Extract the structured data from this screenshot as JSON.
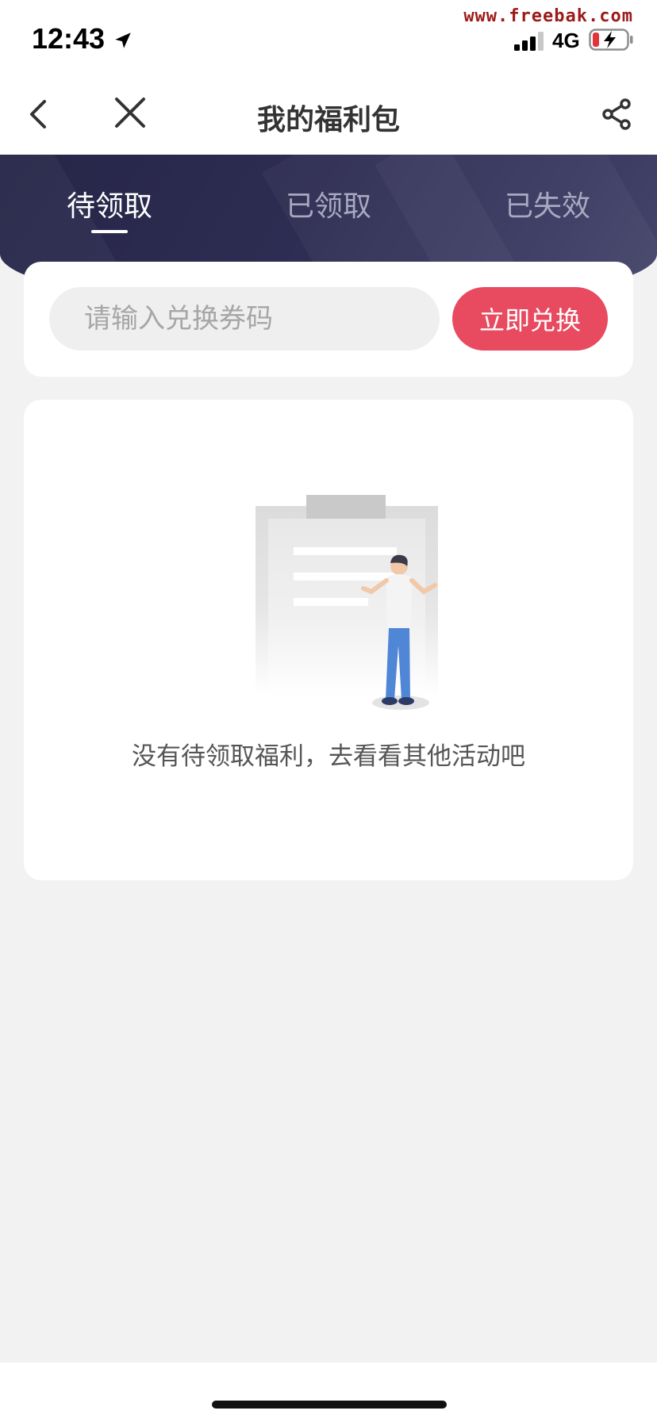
{
  "status_bar": {
    "time": "12:43",
    "network": "4G",
    "watermark": "www.freebak.com",
    "icons": [
      "location-arrow-icon",
      "signal-icon",
      "battery-charging-icon"
    ]
  },
  "nav": {
    "title": "我的福利包",
    "icons": [
      "back-icon",
      "close-icon",
      "share-icon"
    ]
  },
  "tabs": [
    {
      "label": "待领取",
      "active": true
    },
    {
      "label": "已领取",
      "active": false
    },
    {
      "label": "已失效",
      "active": false
    }
  ],
  "redeem": {
    "placeholder": "请输入兑换券码",
    "value": "",
    "button_label": "立即兑换"
  },
  "empty_state": {
    "message": "没有待领取福利，去看看其他活动吧"
  },
  "colors": {
    "header_band": "#2d2c52",
    "accent": "#e84a5f",
    "page_bg": "#f2f2f2"
  }
}
